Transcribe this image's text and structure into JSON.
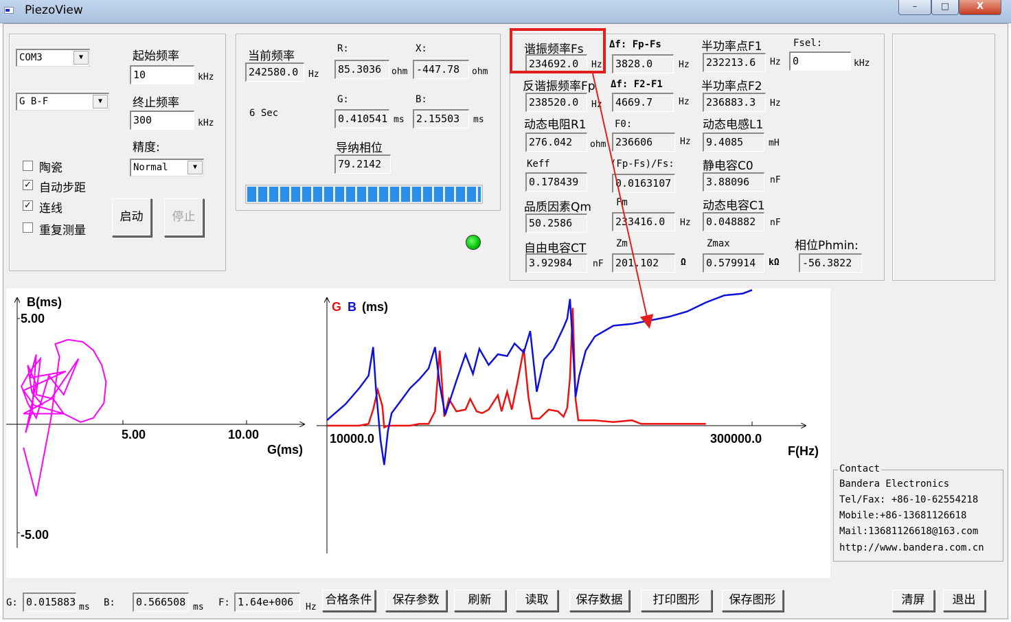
{
  "window": {
    "title": "PiezoView",
    "min_symbol": "–",
    "max_symbol": "□",
    "close_symbol": "X"
  },
  "port": {
    "value": "COM3"
  },
  "mode": {
    "value": "G B-F"
  },
  "freq": {
    "start_label": "起始频率",
    "start_value": "10",
    "start_unit": "kHz",
    "end_label": "终止频率",
    "end_value": "300",
    "end_unit": "kHz",
    "precision_label": "精度:",
    "precision_value": "Normal"
  },
  "options": [
    {
      "label": "陶瓷",
      "checked": false
    },
    {
      "label": "自动步距",
      "checked": true
    },
    {
      "label": "连线",
      "checked": true
    },
    {
      "label": "重复测量",
      "checked": false
    }
  ],
  "buttons": {
    "start": "启动",
    "stop": "停止"
  },
  "current": {
    "freq_label": "当前频率",
    "freq_value": "242580.0",
    "freq_unit": "Hz",
    "time": "6 Sec",
    "r_label": "R:",
    "r_value": "85.3036",
    "r_unit": "ohm",
    "x_label": "X:",
    "x_value": "-447.78",
    "x_unit": "ohm",
    "g_label": "G:",
    "g_value": "0.410541",
    "g_unit": "ms",
    "b_label": "B:",
    "b_value": "2.15503",
    "b_unit": "ms",
    "phase_label": "导纳相位",
    "phase_value": "79.2142"
  },
  "progress": {
    "percent": 100
  },
  "results": {
    "fs_label": "谐振频率Fs",
    "fs_value": "234692.0",
    "fs_unit": "Hz",
    "dffs_label": "Δf: Fp-Fs",
    "dffs_value": "3828.0",
    "dffs_unit": "Hz",
    "f1_label": "半功率点F1",
    "f1_value": "232213.6",
    "f1_unit": "Hz",
    "fsel_label": "Fsel:",
    "fsel_value": "0",
    "fsel_unit": "kHz",
    "fp_label": "反谐振频率Fp",
    "fp_value": "238520.0",
    "fp_unit": "Hz",
    "df21_label": "Δf: F2-F1",
    "df21_value": "4669.7",
    "df21_unit": "Hz",
    "f2_label": "半功率点F2",
    "f2_value": "236883.3",
    "f2_unit": "Hz",
    "r1_label": "动态电阻R1",
    "r1_value": "276.042",
    "r1_unit": "ohm",
    "f0_label": "F0:",
    "f0_value": "236606",
    "f0_unit": "Hz",
    "l1_label": "动态电感L1",
    "l1_value": "9.4085",
    "l1_unit": "mH",
    "keff_label": "Keff",
    "keff_value": "0.178439",
    "fpfs_label": "(Fp-Fs)/Fs:",
    "fpfs_value": "0.0163107",
    "c0_label": "静电容C0",
    "c0_value": "3.88096",
    "c0_unit": "nF",
    "qm_label": "品质因素Qm",
    "qm_value": "50.2586",
    "fm_label": "Fm",
    "fm_value": "233416.0",
    "fm_unit": "Hz",
    "c1_label": "动态电容C1",
    "c1_value": "0.048882",
    "c1_unit": "nF",
    "ct_label": "自由电容CT",
    "ct_value": "3.92984",
    "ct_unit": "nF",
    "zm_label": "Zm",
    "zm_value": "201.102",
    "zm_unit": "Ω",
    "zmax_label": "Zmax",
    "zmax_value": "0.579914",
    "zmax_unit": "kΩ",
    "phmin_label": "相位Phmin:",
    "phmin_value": "-56.3822"
  },
  "chart_data": [
    {
      "type": "line",
      "title": "",
      "ylabel": "B(ms)",
      "xlabel": "G(ms)",
      "y_ticks": [
        "5.00",
        "-5.00"
      ],
      "x_ticks": [
        "5.00",
        "10.00"
      ],
      "xlim": [
        0,
        12.5
      ],
      "ylim": [
        -5.5,
        5.3
      ],
      "series": [
        {
          "color": "#ff00ff",
          "points": [
            [
              0.3,
              -1.1
            ],
            [
              0.9,
              -3.4
            ],
            [
              1.6,
              0.3
            ],
            [
              2.0,
              3.2
            ],
            [
              1.8,
              3.8
            ],
            [
              2.4,
              4.0
            ],
            [
              3.1,
              3.9
            ],
            [
              3.6,
              3.5
            ],
            [
              4.0,
              2.8
            ],
            [
              4.2,
              2.0
            ],
            [
              4.1,
              1.0
            ],
            [
              3.6,
              0.3
            ],
            [
              3.0,
              0.1
            ],
            [
              2.2,
              0.5
            ],
            [
              1.7,
              1.2
            ],
            [
              0.9,
              1.4
            ],
            [
              1.1,
              3.1
            ],
            [
              0.6,
              2.5
            ],
            [
              0.2,
              1.8
            ],
            [
              0.5,
              1.0
            ],
            [
              0.9,
              0.3
            ],
            [
              1.5,
              2.3
            ],
            [
              2.2,
              1.4
            ],
            [
              2.9,
              3.1
            ],
            [
              1.6,
              1.2
            ],
            [
              0.3,
              0.5
            ],
            [
              2.2,
              0.5
            ],
            [
              0.8,
              0.9
            ],
            [
              0.3,
              1.6
            ],
            [
              2.3,
              2.5
            ],
            [
              0.6,
              2.2
            ],
            [
              0.9,
              3.3
            ],
            [
              0.7,
              0.6
            ],
            [
              0.4,
              -0.4
            ],
            [
              0.9,
              1.9
            ],
            [
              0.5,
              2.8
            ],
            [
              0.7,
              1.5
            ],
            [
              1.2,
              0.9
            ]
          ]
        }
      ]
    },
    {
      "type": "line",
      "title": "",
      "legend": [
        "G",
        "B"
      ],
      "ylabel_suffix": "(ms)",
      "xlabel": "F(Hz)",
      "x_ticks": [
        "10000.0",
        "300000.0"
      ],
      "xlim": [
        10000,
        300000
      ],
      "ylim": [
        -2.6,
        7.8
      ],
      "series": [
        {
          "name": "G",
          "color": "#ee1111",
          "points": [
            [
              10000,
              0.0
            ],
            [
              30000,
              0.0
            ],
            [
              45000,
              0.0
            ],
            [
              55000,
              0.1
            ],
            [
              60000,
              0.9
            ],
            [
              65000,
              2.0
            ],
            [
              70000,
              1.1
            ],
            [
              72000,
              -0.1
            ],
            [
              76000,
              0.0
            ],
            [
              100000,
              0.0
            ],
            [
              110000,
              0.1
            ],
            [
              120000,
              0.1
            ],
            [
              127000,
              0.8
            ],
            [
              132000,
              4.2
            ],
            [
              137000,
              0.5
            ],
            [
              142000,
              1.5
            ],
            [
              150000,
              0.8
            ],
            [
              160000,
              0.9
            ],
            [
              165000,
              1.5
            ],
            [
              172000,
              0.8
            ],
            [
              178000,
              0.7
            ],
            [
              185000,
              0.9
            ],
            [
              195000,
              1.7
            ],
            [
              199000,
              0.8
            ],
            [
              205000,
              1.9
            ],
            [
              210000,
              0.9
            ],
            [
              216000,
              2.4
            ],
            [
              223000,
              4.3
            ],
            [
              228000,
              1.6
            ],
            [
              232000,
              0.4
            ],
            [
              240000,
              0.4
            ],
            [
              250000,
              0.9
            ],
            [
              260000,
              0.8
            ],
            [
              266000,
              0.5
            ],
            [
              270000,
              1.0
            ],
            [
              273000,
              2.7
            ],
            [
              276000,
              6.6
            ],
            [
              279000,
              1.5
            ],
            [
              282000,
              0.3
            ],
            [
              300000,
              0.3
            ],
            [
              320000,
              0.2
            ],
            [
              340000,
              0.3
            ],
            [
              350000,
              0.1
            ],
            [
              400000,
              0.1
            ],
            [
              420000,
              0.1
            ]
          ]
        },
        {
          "name": "B",
          "color": "#1010dd",
          "points": [
            [
              10000,
              0.3
            ],
            [
              30000,
              1.2
            ],
            [
              45000,
              2.1
            ],
            [
              55000,
              2.8
            ],
            [
              60000,
              4.4
            ],
            [
              63000,
              2.1
            ],
            [
              68000,
              -0.8
            ],
            [
              72000,
              -2.2
            ],
            [
              76000,
              -0.3
            ],
            [
              80000,
              0.7
            ],
            [
              90000,
              1.4
            ],
            [
              100000,
              2.1
            ],
            [
              110000,
              2.6
            ],
            [
              120000,
              3.2
            ],
            [
              127000,
              4.4
            ],
            [
              132000,
              2.3
            ],
            [
              138000,
              0.6
            ],
            [
              150000,
              2.5
            ],
            [
              160000,
              4.0
            ],
            [
              168000,
              2.9
            ],
            [
              175000,
              4.3
            ],
            [
              185000,
              3.4
            ],
            [
              195000,
              4.0
            ],
            [
              205000,
              3.9
            ],
            [
              213000,
              4.6
            ],
            [
              223000,
              4.1
            ],
            [
              230000,
              5.3
            ],
            [
              237000,
              1.9
            ],
            [
              245000,
              3.7
            ],
            [
              255000,
              4.3
            ],
            [
              266000,
              5.5
            ],
            [
              270000,
              6.0
            ],
            [
              273000,
              7.1
            ],
            [
              276000,
              4.6
            ],
            [
              279000,
              1.6
            ],
            [
              283000,
              2.8
            ],
            [
              290000,
              4.2
            ],
            [
              300000,
              5.0
            ],
            [
              320000,
              5.6
            ],
            [
              340000,
              5.7
            ],
            [
              360000,
              5.9
            ],
            [
              380000,
              6.1
            ],
            [
              400000,
              6.4
            ],
            [
              420000,
              6.9
            ],
            [
              440000,
              7.3
            ],
            [
              460000,
              7.4
            ],
            [
              470000,
              7.6
            ]
          ]
        }
      ]
    }
  ],
  "contact": {
    "title": "Contact",
    "company": "Bandera Electronics",
    "tel": "Tel/Fax: +86-10-62554218",
    "mobile": "Mobile:+86-13681126618",
    "mail": "Mail:13681126618@163.com",
    "web": "http://www.bandera.com.cn"
  },
  "statusbar": {
    "g_label": "G:",
    "g_value": "0.015883",
    "g_unit": "ms",
    "b_label": "B:",
    "b_value": "0.566508",
    "b_unit": "ms",
    "f_label": "F:",
    "f_value": "1.64e+006",
    "f_unit": "Hz"
  },
  "toolbar": {
    "criteria": "合格条件",
    "save_params": "保存参数",
    "refresh": "刷新",
    "read": "读取",
    "save_data": "保存数据",
    "print_graph": "打印图形",
    "save_graph": "保存图形",
    "clear": "清屏",
    "exit": "退出"
  },
  "colors": {
    "highlight": "#e21f1f",
    "progress": "#2b8fe6",
    "led": "#05c105"
  }
}
